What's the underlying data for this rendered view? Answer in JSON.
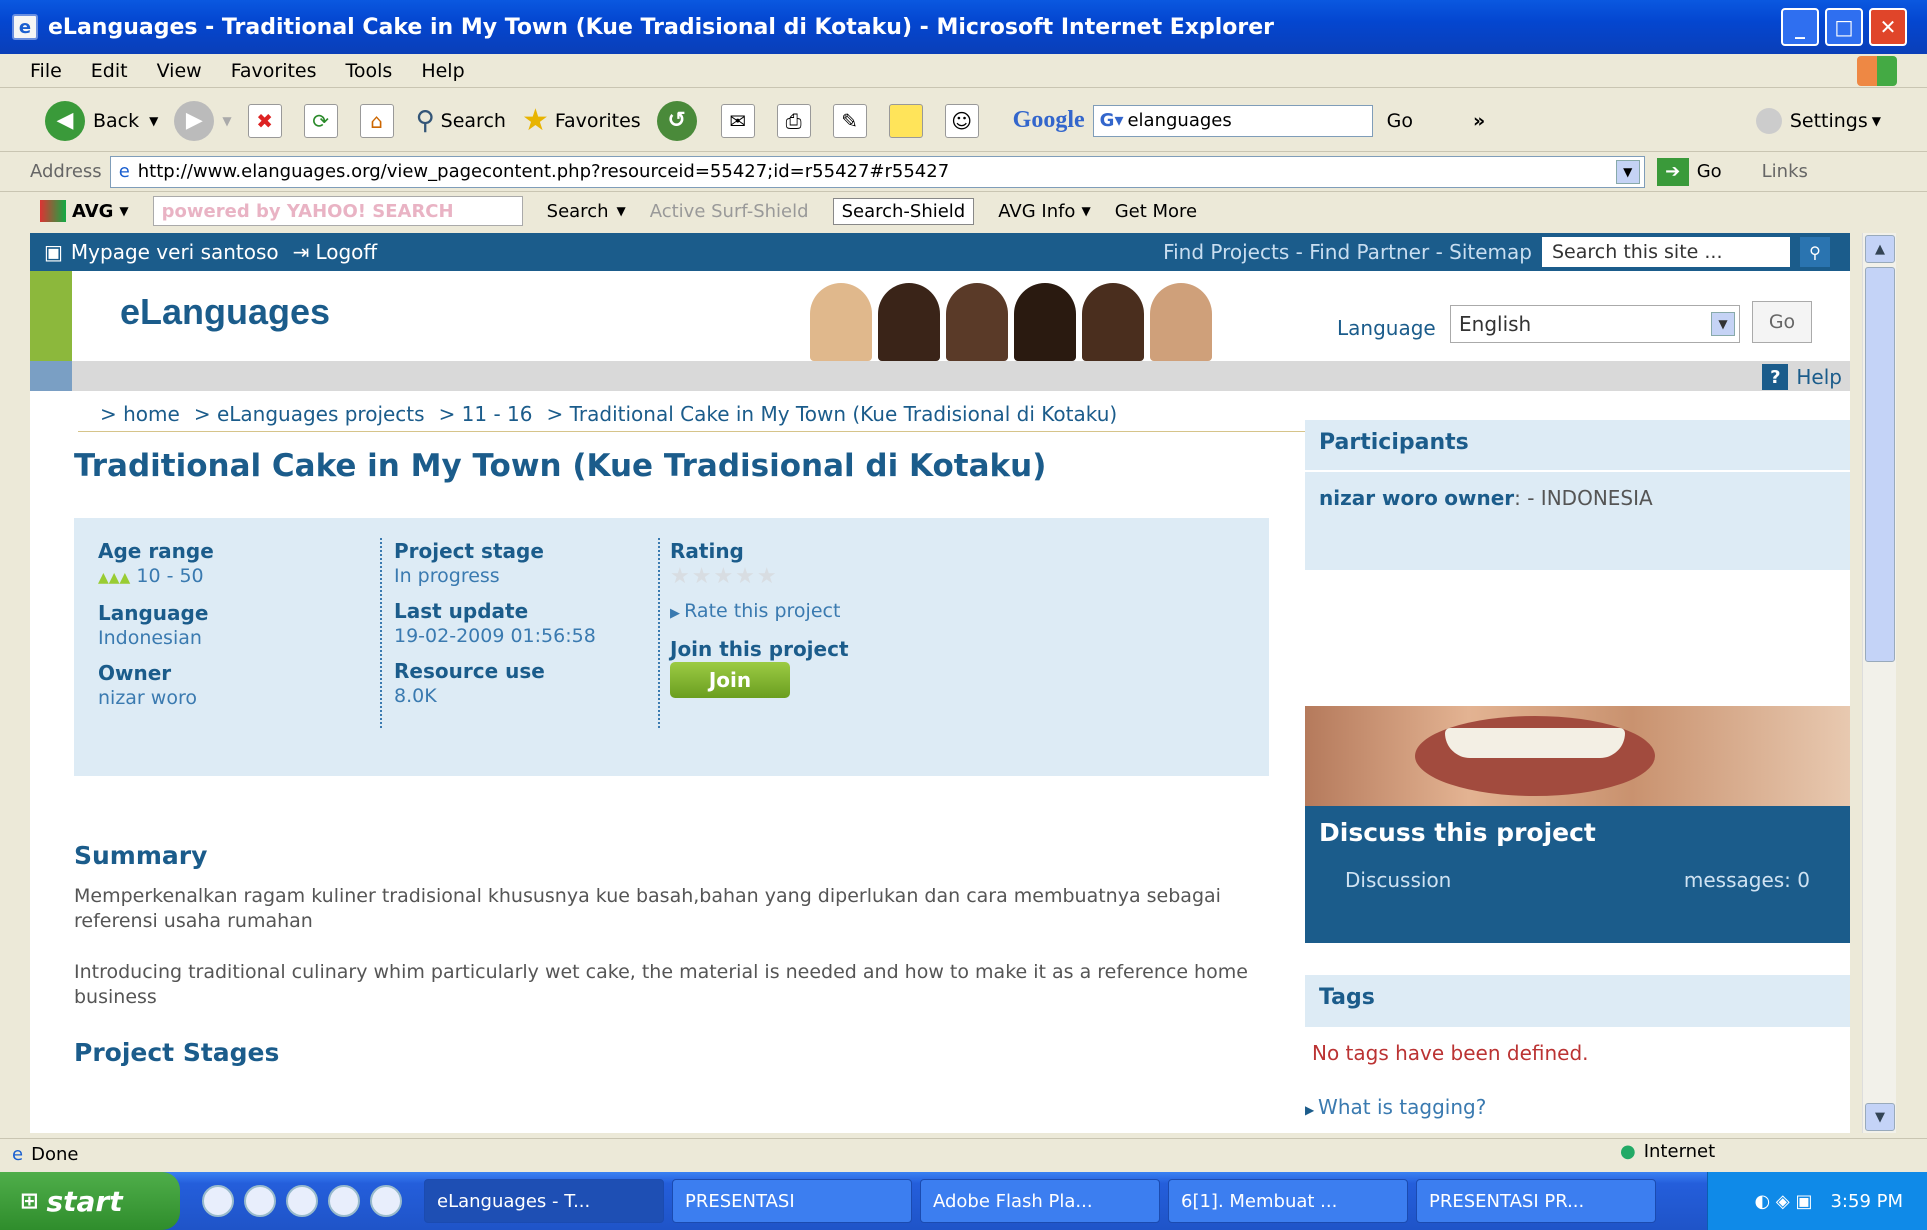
{
  "window": {
    "title": "eLanguages - Traditional Cake in My Town (Kue Tradisional di Kotaku) - Microsoft Internet Explorer"
  },
  "menu": [
    "File",
    "Edit",
    "View",
    "Favorites",
    "Tools",
    "Help"
  ],
  "toolbar": {
    "back": "Back",
    "search": "Search",
    "favorites": "Favorites",
    "google": "Google",
    "google_query": "elanguages",
    "go": "Go",
    "settings": "Settings"
  },
  "address": {
    "label": "Address",
    "url": "http://www.elanguages.org/view_pagecontent.php?resourceid=55427;id=r55427#r55427",
    "go": "Go",
    "links": "Links"
  },
  "avgbar": {
    "avg": "AVG",
    "yahoo": "powered by YAHOO! SEARCH",
    "search": "Search",
    "active": "Active Surf-Shield",
    "searchshield": "Search-Shield",
    "info": "AVG Info",
    "more": "Get More"
  },
  "topnav": {
    "mypage": "Mypage veri santoso",
    "logoff": "Logoff",
    "find_projects": "Find Projects",
    "find_partner": "Find Partner",
    "sitemap": "Sitemap",
    "search_placeholder": "Search this site ..."
  },
  "header": {
    "logo": "eLanguages",
    "language_label": "Language",
    "language_value": "English",
    "go": "Go",
    "help": "Help"
  },
  "breadcrumb": [
    "> home",
    "> eLanguages projects",
    "> 11 - 16",
    "> Traditional Cake in My Town (Kue Tradisional di Kotaku)"
  ],
  "page": {
    "title": "Traditional Cake in My Town (Kue Tradisional di Kotaku)"
  },
  "info": {
    "age_label": "Age range",
    "age_value": "10 - 50",
    "language_label": "Language",
    "language_value": "Indonesian",
    "owner_label": "Owner",
    "owner_value": "nizar woro",
    "stage_label": "Project stage",
    "stage_value": "In progress",
    "update_label": "Last update",
    "update_value": "19-02-2009 01:56:58",
    "resource_label": "Resource use",
    "resource_value": "8.0K",
    "rating_label": "Rating",
    "rating_stars": 0,
    "rate_link": "Rate this project",
    "join_label": "Join this project",
    "join_button": "Join"
  },
  "summary": {
    "heading": "Summary",
    "text1": "Memperkenalkan ragam kuliner tradisional khususnya kue basah,bahan yang diperlukan dan cara membuatnya sebagai referensi usaha rumahan",
    "text2": "Introducing traditional culinary whim particularly wet cake, the material is needed and how to make it as a reference home business"
  },
  "stages": {
    "heading": "Project Stages"
  },
  "participants": {
    "heading": "Participants",
    "name": "nizar woro",
    "role": "owner",
    "country": ": - INDONESIA"
  },
  "discuss": {
    "heading": "Discuss this project",
    "link": "Discussion",
    "count": "messages: 0"
  },
  "tags": {
    "heading": "Tags",
    "empty": "No tags have been defined.",
    "help_link": "What is tagging?"
  },
  "status": {
    "text": "Done",
    "zone": "Internet"
  },
  "taskbar": {
    "start": "start",
    "tasks": [
      "eLanguages - T...",
      "PRESENTASI",
      "Adobe Flash Pla...",
      "6[1]. Membuat ...",
      "PRESENTASI PR..."
    ],
    "clock": "3:59 PM"
  }
}
